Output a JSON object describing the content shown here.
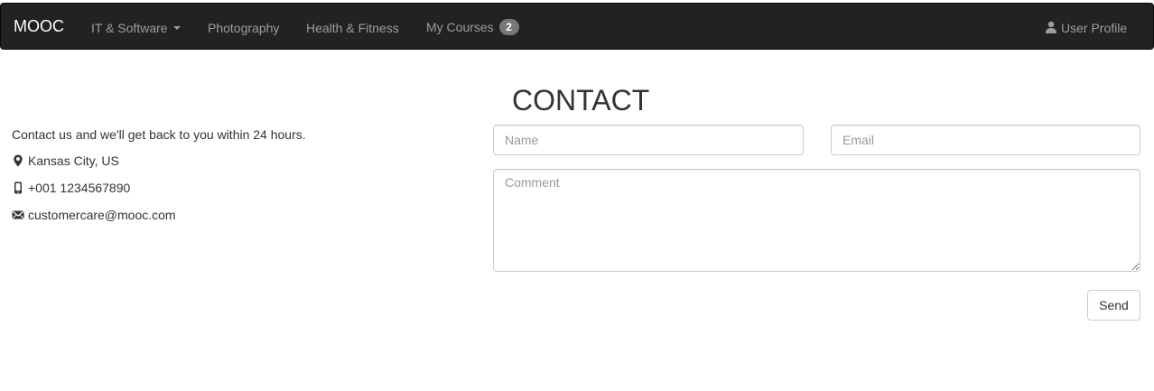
{
  "navbar": {
    "brand": "MOOC",
    "items": [
      {
        "label": "IT & Software",
        "dropdown": true
      },
      {
        "label": "Photography"
      },
      {
        "label": "Health & Fitness"
      },
      {
        "label": "My Courses",
        "badge": "2"
      }
    ],
    "user_profile": {
      "label": "User Profile",
      "icon": "user-icon"
    }
  },
  "page": {
    "title": "CONTACT"
  },
  "contact_info": {
    "intro": "Contact us and we'll get back to you within 24 hours.",
    "location": {
      "icon": "map-marker-icon",
      "text": "Kansas City, US"
    },
    "phone": {
      "icon": "phone-icon",
      "text": "+001 1234567890"
    },
    "email": {
      "icon": "envelope-icon",
      "text": "customercare@mooc.com"
    }
  },
  "form": {
    "name_placeholder": "Name",
    "email_placeholder": "Email",
    "comment_placeholder": "Comment",
    "send_label": "Send"
  },
  "colors": {
    "navbar_bg": "#222222",
    "navbar_text": "#9d9d9d",
    "brand_text": "#ffffff",
    "badge_bg": "#777777"
  }
}
